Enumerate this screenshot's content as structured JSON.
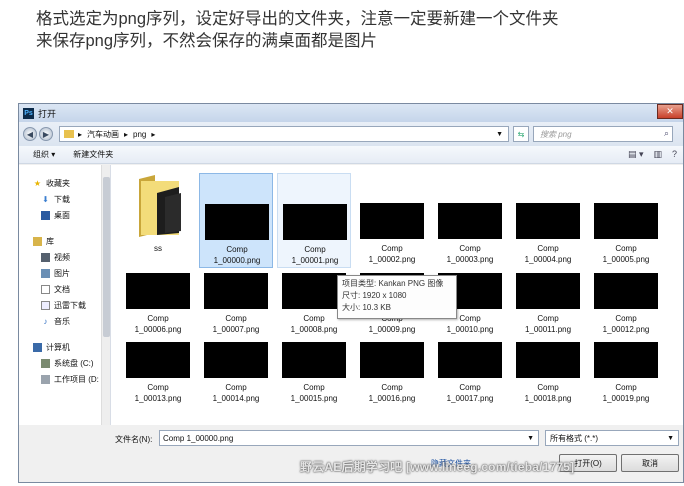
{
  "caption": {
    "line1": "格式选定为png序列，设定好导出的文件夹，注意一定要新建一个文件夹",
    "line2": "来保存png序列，不然会保存的满桌面都是图片"
  },
  "window": {
    "title": "打开",
    "app_icon_label": "Ps"
  },
  "address": {
    "crumbs": [
      "汽车动画",
      "png"
    ],
    "search_placeholder": "搜索 png"
  },
  "toolbar": {
    "organize": "组织 ▾",
    "new_folder": "新建文件夹"
  },
  "sidebar": {
    "favorites": "收藏夹",
    "fav_items": [
      "下载",
      "桌面"
    ],
    "libraries": "库",
    "lib_items": [
      "视频",
      "图片",
      "文档",
      "迅雷下载",
      "音乐"
    ],
    "computer": "计算机",
    "drives": [
      "系统盘 (C:)",
      "工作项目 (D:"
    ]
  },
  "folder": {
    "name": "ss"
  },
  "files": [
    {
      "l1": "Comp",
      "l2": "1_00000.png"
    },
    {
      "l1": "Comp",
      "l2": "1_00001.png"
    },
    {
      "l1": "Comp",
      "l2": "1_00002.png"
    },
    {
      "l1": "Comp",
      "l2": "1_00003.png"
    },
    {
      "l1": "Comp",
      "l2": "1_00004.png"
    },
    {
      "l1": "Comp",
      "l2": "1_00005.png"
    },
    {
      "l1": "Comp",
      "l2": "1_00006.png"
    },
    {
      "l1": "Comp",
      "l2": "1_00007.png"
    },
    {
      "l1": "Comp",
      "l2": "1_00008.png"
    },
    {
      "l1": "Comp",
      "l2": "1_00009.png"
    },
    {
      "l1": "Comp",
      "l2": "1_00010.png"
    },
    {
      "l1": "Comp",
      "l2": "1_00011.png"
    },
    {
      "l1": "Comp",
      "l2": "1_00012.png"
    },
    {
      "l1": "Comp",
      "l2": "1_00013.png"
    },
    {
      "l1": "Comp",
      "l2": "1_00014.png"
    },
    {
      "l1": "Comp",
      "l2": "1_00015.png"
    },
    {
      "l1": "Comp",
      "l2": "1_00016.png"
    },
    {
      "l1": "Comp",
      "l2": "1_00017.png"
    },
    {
      "l1": "Comp",
      "l2": "1_00018.png"
    },
    {
      "l1": "Comp",
      "l2": "1_00019.png"
    }
  ],
  "tooltip": {
    "type": "项目类型: Kankan PNG 图像",
    "dims": "尺寸: 1920 x 1080",
    "size": "大小: 10.3 KB"
  },
  "bottom": {
    "filename_label": "文件名(N):",
    "filename_value": "Comp 1_00000.png",
    "filetype_value": "所有格式 (*.*)",
    "hide_folders": "隐藏文件夹",
    "open_button": "打开(O)",
    "cancel_button": "取消"
  },
  "watermark": "野云AE后期学习吧 [www.lineeg.com/tieba/1775]"
}
